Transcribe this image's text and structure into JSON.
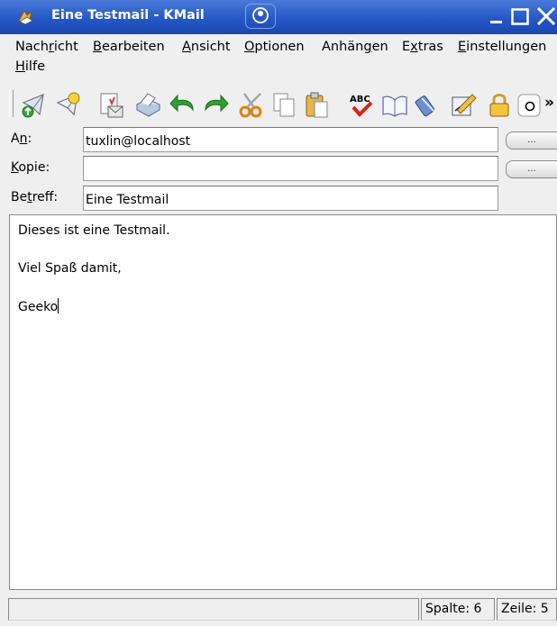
{
  "window": {
    "title": "Eine Testmail - KMail",
    "icons": {
      "app": "kmail-icon",
      "sticky": "sticky-pin-icon",
      "minimize": "minimize-icon",
      "maximize": "maximize-icon",
      "close": "close-icon"
    },
    "title_bar_color": "#2a5cc8"
  },
  "menu": [
    {
      "pre": "Nach",
      "u": "r",
      "post": "icht"
    },
    {
      "pre": "",
      "u": "B",
      "post": "earbeiten"
    },
    {
      "pre": "",
      "u": "A",
      "post": "nsicht"
    },
    {
      "pre": "",
      "u": "O",
      "post": "ptionen"
    },
    {
      "pre": "Anhän",
      "u": "g",
      "post": "en"
    },
    {
      "pre": "E",
      "u": "x",
      "post": "tras"
    },
    {
      "pre": "",
      "u": "E",
      "post": "instellungen"
    },
    {
      "pre": "",
      "u": "H",
      "post": "ilfe"
    }
  ],
  "toolbar": {
    "buttons": [
      "send-icon",
      "queue-icon",
      "save-draft-icon",
      "print-icon",
      "undo-icon",
      "redo-icon",
      "cut-icon",
      "copy-icon",
      "paste-icon",
      "spellcheck-icon",
      "address-book-icon",
      "attach-icon",
      "sign-icon",
      "encrypt-lock-icon",
      "clear-icon"
    ],
    "overflow": "»"
  },
  "compose": {
    "to": {
      "pre": "A",
      "u": "n",
      "post": ":",
      "value": "tuxlin@localhost",
      "button": "..."
    },
    "cc": {
      "pre": "",
      "u": "K",
      "post": "opie:",
      "value": "",
      "button": "..."
    },
    "subject": {
      "pre": "Be",
      "u": "t",
      "post": "reff:",
      "value": "Eine Testmail"
    },
    "body_lines": [
      "Dieses ist eine Testmail.",
      "Viel Spaß damit,",
      "Geeko"
    ]
  },
  "status": {
    "message": "",
    "column": "Spalte: 6",
    "line": "Zeile: 5"
  }
}
